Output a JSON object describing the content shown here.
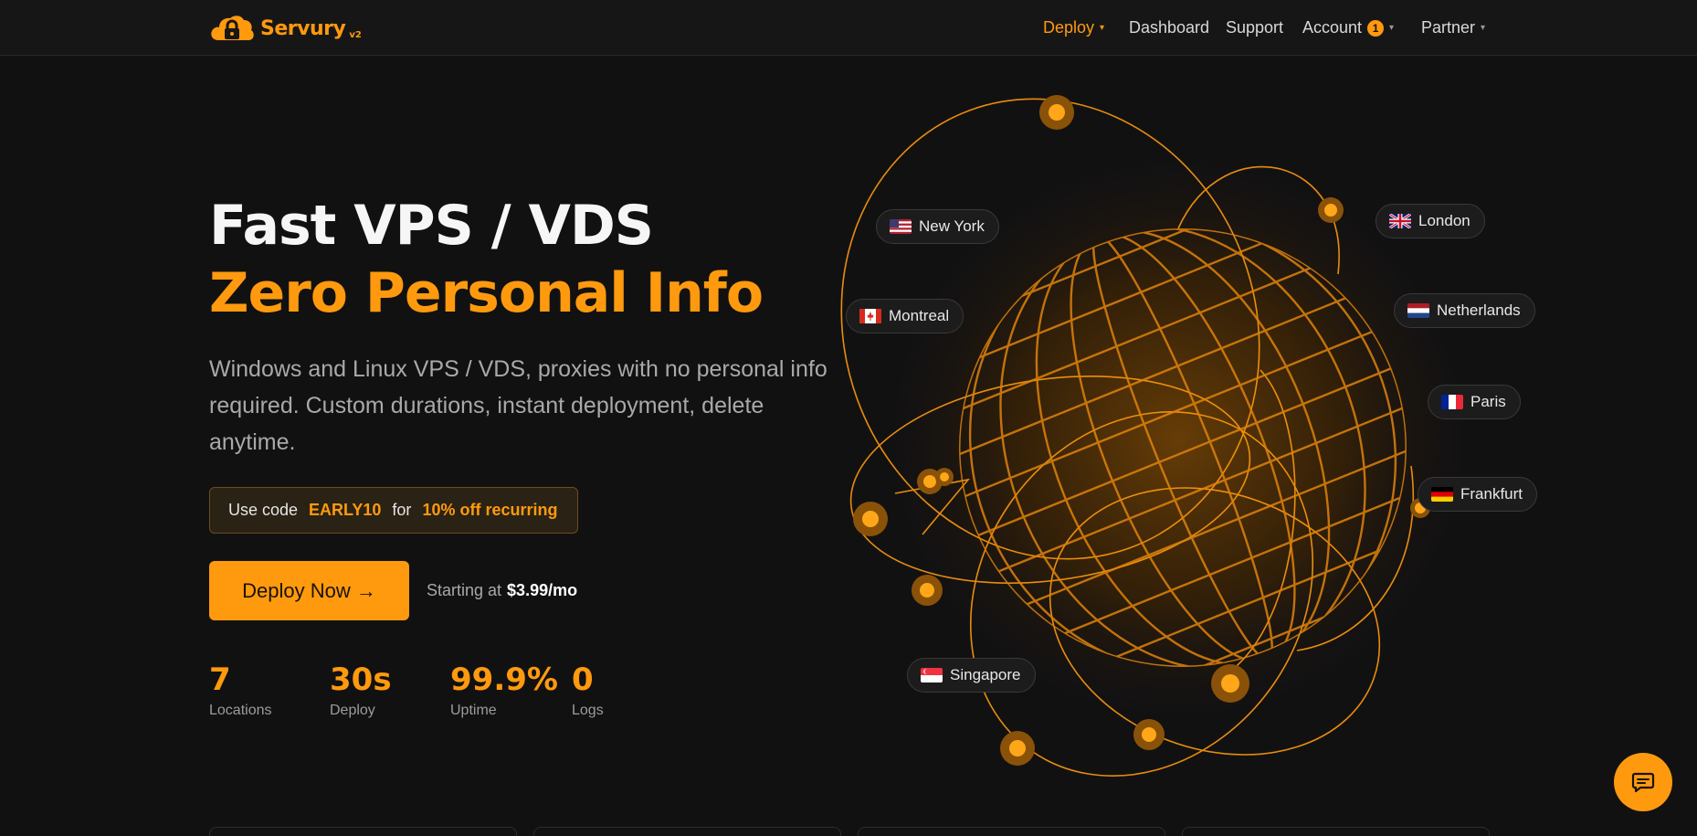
{
  "nav": {
    "brand": "Servury",
    "brand_version": "v2",
    "items": [
      {
        "label": "Deploy",
        "caret": "▾"
      },
      {
        "label": "Dashboard"
      },
      {
        "label": "Support"
      },
      {
        "label": "Account",
        "badge": "1",
        "caret": "▾"
      },
      {
        "label": "Partner",
        "caret": "▾"
      }
    ]
  },
  "hero": {
    "title_line1": "Fast VPS / VDS",
    "title_line2": "Zero Personal Info",
    "subtitle": "Windows and Linux VPS / VDS, proxies with no personal info required. Custom durations, instant deployment, delete anytime.",
    "promo": {
      "prefix": "Use code",
      "code": "EARLY10",
      "middle": "for",
      "offer": "10% off recurring"
    },
    "cta_label": "Deploy Now →",
    "starting_prefix": "Starting at",
    "starting_price": "$3.99/mo",
    "stats": [
      {
        "value": "7",
        "label": "Locations"
      },
      {
        "value": "30s",
        "label": "Deploy"
      },
      {
        "value": "99.9%",
        "label": "Uptime"
      },
      {
        "value": "0",
        "label": "Logs"
      }
    ]
  },
  "locations": [
    {
      "name": "New York",
      "flag": "us-flag-icon"
    },
    {
      "name": "London",
      "flag": "uk-flag-icon"
    },
    {
      "name": "Montreal",
      "flag": "ca-flag-icon"
    },
    {
      "name": "Netherlands",
      "flag": "nl-flag-icon"
    },
    {
      "name": "Paris",
      "flag": "fr-flag-icon"
    },
    {
      "name": "Frankfurt",
      "flag": "de-flag-icon"
    },
    {
      "name": "Singapore",
      "flag": "sg-flag-icon"
    }
  ],
  "colors": {
    "accent": "#ff9a0e",
    "background": "#121112",
    "nav_background": "#171617"
  },
  "icons": {
    "logo": "cloud-lock-icon",
    "chat": "chat-bubble-icon"
  }
}
